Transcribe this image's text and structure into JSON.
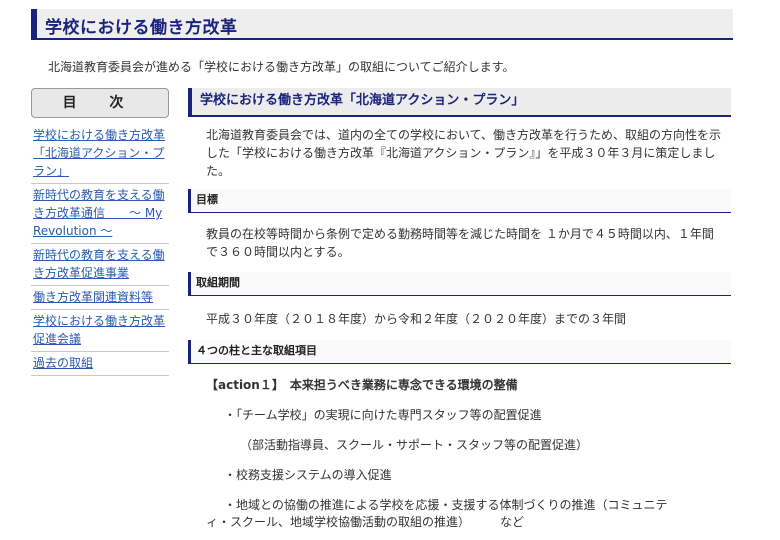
{
  "header": {
    "title": "学校における働き方改革",
    "intro": "北海道教育委員会が進める「学校における働き方改革」の取組についてご紹介します。"
  },
  "sidebar": {
    "heading": "目 次",
    "items": [
      {
        "label": "学校における働き方改革「北海道アクション・プラン」"
      },
      {
        "label": "新時代の教育を支える働き方改革通信　　～ My Revolution ～"
      },
      {
        "label": "新時代の教育を支える働き方改革促進事業"
      },
      {
        "label": "働き方改革関連資料等"
      },
      {
        "label": "学校における働き方改革促進会議"
      },
      {
        "label": "過去の取組"
      }
    ]
  },
  "main": {
    "section_title": "学校における働き方改革「北海道アクション・プラン」",
    "section_text": "北海道教育委員会では、道内の全ての学校において、働き方改革を行うため、取組の方向性を示した「学校における働き方改革『北海道アクション・プラン』」を平成３０年３月に策定しました。",
    "goal_heading": "目標",
    "goal_text": "教員の在校等時間から条例で定める勤務時間等を減じた時間を １か月で４５時間以内、１年間で３６０時間以内とする。",
    "period_heading": "取組期間",
    "period_text": "平成３０年度（２０１８年度）から令和２年度（２０２０年度）までの３年間",
    "pillars_heading": "４つの柱と主な取組項目",
    "action1": "【action１】　本来担うべき業務に専念できる環境の整備",
    "bullet1": "・「チーム学校」の実現に向けた専門スタッフ等の配置促進",
    "bullet1_sub": "（部活動指導員、スクール・サポート・スタッフ等の配置促進）",
    "bullet2": "・校務支援システムの導入促進",
    "bullet3_line1": "・地域との協働の推進による学校を応援・支援する体制づくりの推進（コミュニテ",
    "bullet3_line2": "ィ・スクール、地域学校協働活動の取組の推進）　　　など"
  }
}
